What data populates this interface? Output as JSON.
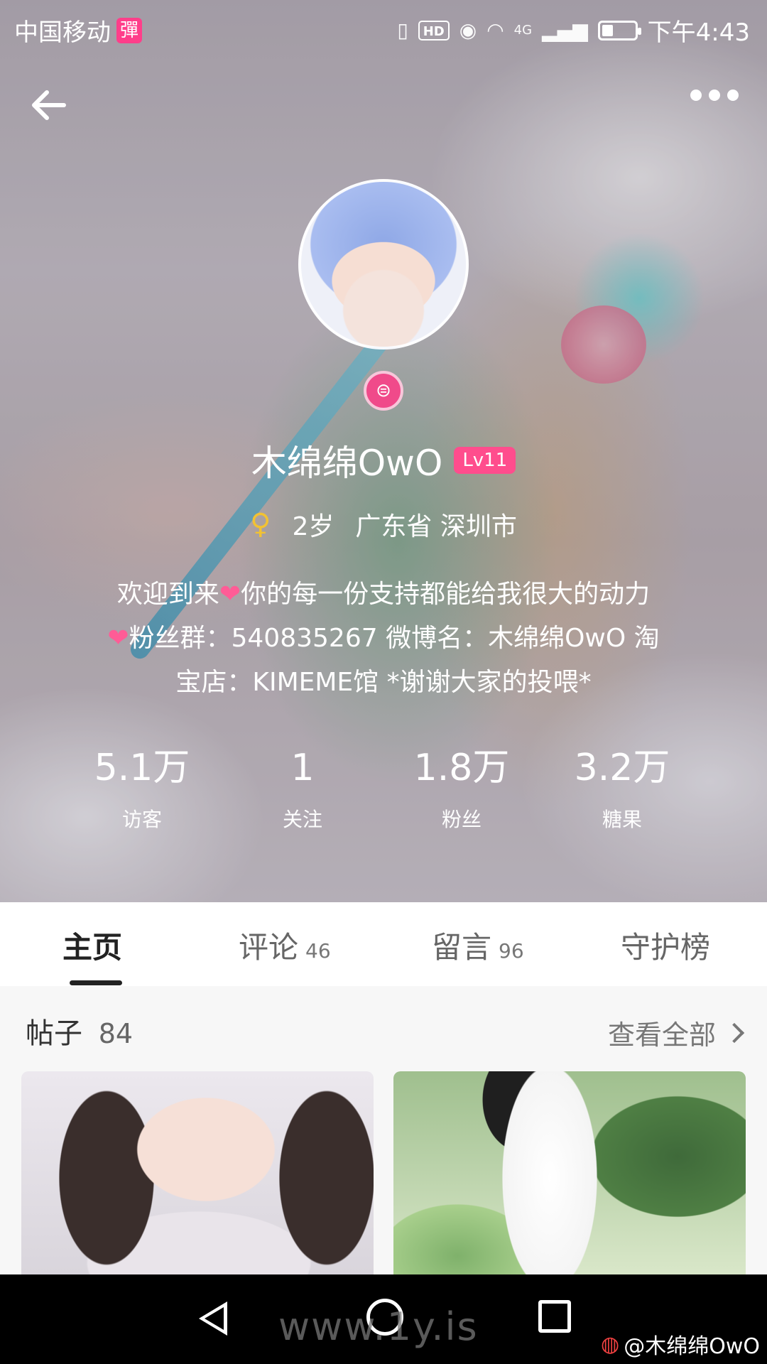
{
  "status_bar": {
    "carrier": "中国移动",
    "carrier_badge": "彈",
    "hd": "HD",
    "network": "4G",
    "time": "下午4:43",
    "battery_level": 0.35
  },
  "profile": {
    "name": "木绵绵OwO",
    "level": "Lv11",
    "verify_badge": "⊜",
    "age": "2岁",
    "location": "广东省 深圳市",
    "bio_line1": "欢迎到来",
    "bio_line1b": "你的每一份支持都能给我很大的动力",
    "bio_line2": "粉丝群：540835267  微博名：木绵绵OwO 淘",
    "bio_line3": "宝店：KIMEME馆 *谢谢大家的投喂*",
    "stats": [
      {
        "value": "5.1万",
        "label": "访客"
      },
      {
        "value": "1",
        "label": "关注"
      },
      {
        "value": "1.8万",
        "label": "粉丝"
      },
      {
        "value": "3.2万",
        "label": "糖果"
      }
    ]
  },
  "tabs": [
    {
      "label": "主页",
      "count": "",
      "active": true
    },
    {
      "label": "评论",
      "count": "46",
      "active": false
    },
    {
      "label": "留言",
      "count": "96",
      "active": false
    },
    {
      "label": "守护榜",
      "count": "",
      "active": false
    }
  ],
  "posts": {
    "title": "帖子",
    "count": "84",
    "view_all": "查看全部"
  },
  "watermark": "www.1y.is",
  "weibo_mark": "@木绵绵OwO",
  "colors": {
    "accent_pink": "#ff4d8d",
    "nav_bg": "#000000"
  }
}
